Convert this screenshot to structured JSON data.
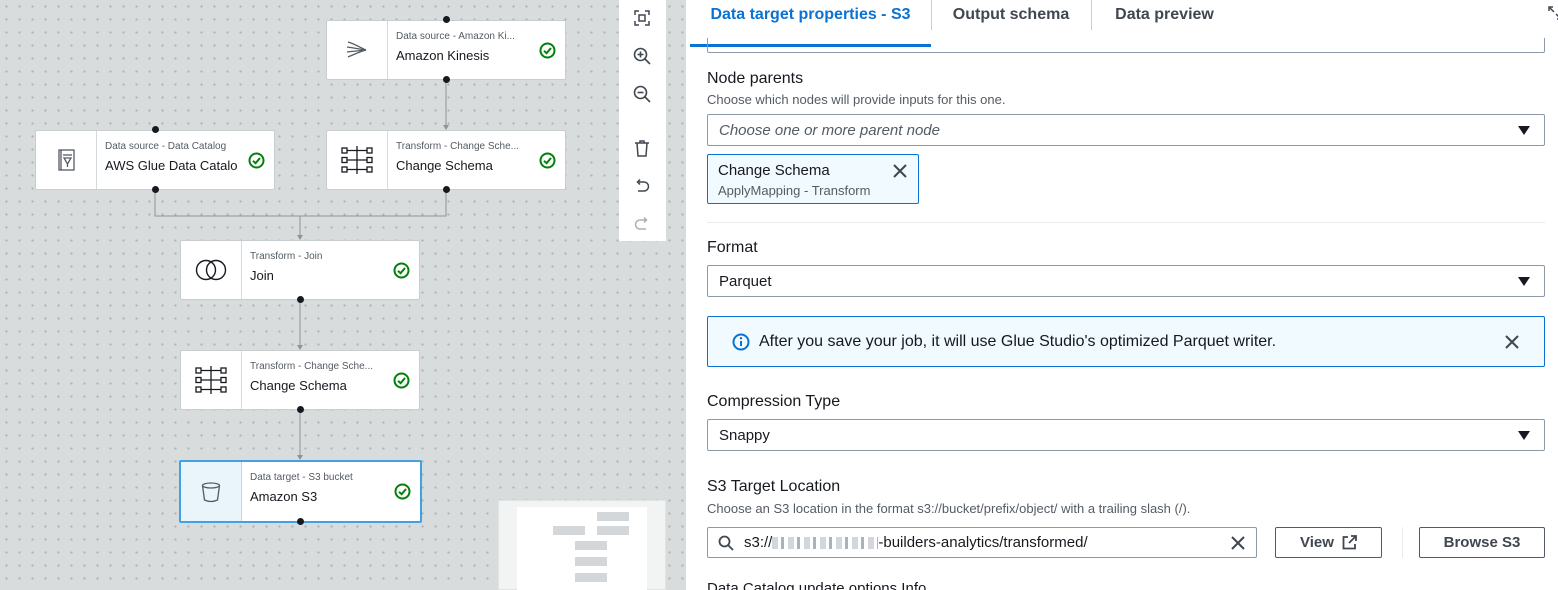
{
  "canvas": {
    "nodes": [
      {
        "id": "kinesis",
        "type_label": "Data source - Amazon Ki...",
        "name": "Amazon Kinesis",
        "icon": "kinesis-icon",
        "status": "valid"
      },
      {
        "id": "catalog",
        "type_label": "Data source - Data Catalog",
        "name": "AWS Glue Data Catalog",
        "icon": "data-catalog-icon",
        "status": "valid"
      },
      {
        "id": "change1",
        "type_label": "Transform - Change Sche...",
        "name": "Change Schema",
        "icon": "apply-mapping-icon",
        "status": "valid"
      },
      {
        "id": "join",
        "type_label": "Transform - Join",
        "name": "Join",
        "icon": "join-icon",
        "status": "valid"
      },
      {
        "id": "change2",
        "type_label": "Transform - Change Sche...",
        "name": "Change Schema",
        "icon": "apply-mapping-icon",
        "status": "valid"
      },
      {
        "id": "s3",
        "type_label": "Data target - S3 bucket",
        "name": "Amazon S3",
        "icon": "bucket-icon",
        "status": "valid",
        "selected": true
      }
    ],
    "toolbar": [
      "fit-view-icon",
      "zoom-in-icon",
      "zoom-out-icon",
      "delete-icon",
      "undo-icon",
      "redo-icon"
    ]
  },
  "tabs": [
    {
      "label": "Data target properties - S3",
      "active": true
    },
    {
      "label": "Output schema",
      "active": false
    },
    {
      "label": "Data preview",
      "active": false
    }
  ],
  "node_parents": {
    "label": "Node parents",
    "description": "Choose which nodes will provide inputs for this one.",
    "placeholder": "Choose one or more parent node",
    "token": {
      "title": "Change Schema",
      "subtitle": "ApplyMapping - Transform"
    }
  },
  "format": {
    "label": "Format",
    "value": "Parquet"
  },
  "alert": {
    "text": "After you save your job, it will use Glue Studio's optimized Parquet writer."
  },
  "compression": {
    "label": "Compression Type",
    "value": "Snappy"
  },
  "s3_target": {
    "label": "S3 Target Location",
    "description": "Choose an S3 location in the format s3://bucket/prefix/object/ with a trailing slash (/).",
    "value_prefix": "s3://",
    "value_suffix": "-builders-analytics/transformed/",
    "view_label": "View",
    "browse_label": "Browse S3"
  },
  "next_section": {
    "label": "Data Catalog update options  Info"
  },
  "colors": {
    "accent": "#0972d3",
    "success": "#037f0c",
    "selected_node_border": "#44a0e0"
  }
}
